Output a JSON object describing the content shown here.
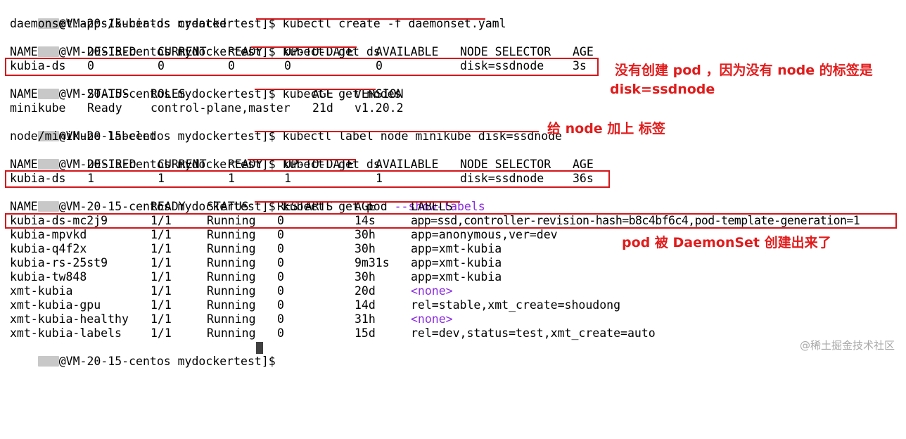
{
  "prompt": {
    "host": "@VM-20-15-centos mydockertest]$"
  },
  "commands": {
    "c1": "kubectl create -f daemonset.yaml",
    "c2": "kubectl get ds",
    "c3": "kubectl get nodes",
    "c4": "kubectl label node minikube disk=ssdnode",
    "c5": "kubectl get ds",
    "c6_main": "kubectl get pod ",
    "c6_flag": "--show-labels"
  },
  "outputs": {
    "created": "daemonset.apps/kubia-ds created",
    "labeled": "node/minikube labeled"
  },
  "ds_headers": [
    "NAME",
    "DESIRED",
    "CURRENT",
    "READY",
    "UP-TO-DATE",
    "AVAILABLE",
    "NODE SELECTOR",
    "AGE"
  ],
  "ds_row_1": [
    "kubia-ds",
    "0",
    "0",
    "0",
    "0",
    "0",
    "disk=ssdnode",
    "3s"
  ],
  "ds_row_2": [
    "kubia-ds",
    "1",
    "1",
    "1",
    "1",
    "1",
    "disk=ssdnode",
    "36s"
  ],
  "nodes_headers": [
    "NAME",
    "STATUS",
    "ROLES",
    "AGE",
    "VERSION"
  ],
  "nodes_row": [
    "minikube",
    "Ready",
    "control-plane,master",
    "21d",
    "v1.20.2"
  ],
  "pods_headers": [
    "NAME",
    "READY",
    "STATUS",
    "RESTARTS",
    "AGE",
    "LABELS"
  ],
  "pods_rows": [
    [
      "kubia-ds-mc2j9",
      "1/1",
      "Running",
      "0",
      "14s",
      "app=ssd,controller-revision-hash=b8c4bf6c4,pod-template-generation=1"
    ],
    [
      "kubia-mpvkd",
      "1/1",
      "Running",
      "0",
      "30h",
      "app=anonymous,ver=dev"
    ],
    [
      "kubia-q4f2x",
      "1/1",
      "Running",
      "0",
      "30h",
      "app=xmt-kubia"
    ],
    [
      "kubia-rs-25st9",
      "1/1",
      "Running",
      "0",
      "9m31s",
      "app=xmt-kubia"
    ],
    [
      "kubia-tw848",
      "1/1",
      "Running",
      "0",
      "30h",
      "app=xmt-kubia"
    ],
    [
      "xmt-kubia",
      "1/1",
      "Running",
      "0",
      "20d",
      "<none>"
    ],
    [
      "xmt-kubia-gpu",
      "1/1",
      "Running",
      "0",
      "14d",
      "rel=stable,xmt_create=shoudong"
    ],
    [
      "xmt-kubia-healthy",
      "1/1",
      "Running",
      "0",
      "31h",
      "<none>"
    ],
    [
      "xmt-kubia-labels",
      "1/1",
      "Running",
      "0",
      "15d",
      "rel=dev,status=test,xmt_create=auto"
    ]
  ],
  "annotations": {
    "a1_line1": "没有创建 pod ，因为没有 node 的标签是",
    "a1_line2": "disk=ssdnode",
    "a2": "给 node 加上 标签",
    "a3": "pod 被 DaemonSet 创建出来了"
  },
  "watermark": "@稀土掘金技术社区",
  "colors": {
    "background": "#ffffff",
    "text": "#000000",
    "accent_red": "#d3161b",
    "none_purple": "#8a2be2"
  }
}
